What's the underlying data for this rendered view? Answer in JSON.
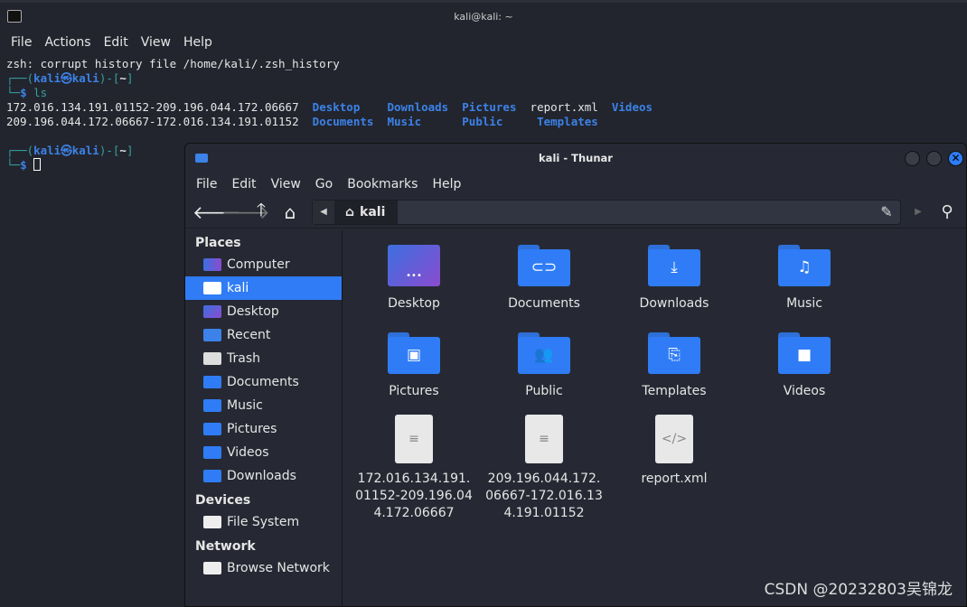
{
  "terminal": {
    "title": "kali@kali: ~",
    "menu": [
      "File",
      "Actions",
      "Edit",
      "View",
      "Help"
    ],
    "warning": "zsh: corrupt history file /home/kali/.zsh_history",
    "prompt_user": "kali",
    "prompt_host": "kali",
    "prompt_dir": "~",
    "command": "ls",
    "ls_files": [
      "172.016.134.191.01152-209.196.044.172.06667",
      "209.196.044.172.06667-172.016.134.191.01152",
      "report.xml"
    ],
    "ls_dirs": [
      "Desktop",
      "Downloads",
      "Pictures",
      "Videos",
      "Documents",
      "Music",
      "Public",
      "Templates"
    ]
  },
  "thunar": {
    "title": "kali - Thunar",
    "menu": [
      "File",
      "Edit",
      "View",
      "Go",
      "Bookmarks",
      "Help"
    ],
    "path": "kali",
    "sidebar": {
      "places_label": "Places",
      "places": [
        "Computer",
        "kali",
        "Desktop",
        "Recent",
        "Trash",
        "Documents",
        "Music",
        "Pictures",
        "Videos",
        "Downloads"
      ],
      "selected": "kali",
      "devices_label": "Devices",
      "devices": [
        "File System"
      ],
      "network_label": "Network",
      "network": [
        "Browse Network"
      ]
    },
    "items": [
      {
        "name": "Desktop",
        "icon": "desktop"
      },
      {
        "name": "Documents",
        "icon": "paperclip"
      },
      {
        "name": "Downloads",
        "icon": "download"
      },
      {
        "name": "Music",
        "icon": "music"
      },
      {
        "name": "Pictures",
        "icon": "image"
      },
      {
        "name": "Public",
        "icon": "people"
      },
      {
        "name": "Templates",
        "icon": "template"
      },
      {
        "name": "Videos",
        "icon": "video"
      },
      {
        "name": "172.016.134.191.01152-209.196.044.172.06667",
        "icon": "text"
      },
      {
        "name": "209.196.044.172.06667-172.016.134.191.01152",
        "icon": "text"
      },
      {
        "name": "report.xml",
        "icon": "xml"
      }
    ]
  },
  "watermark": "CSDN @20232803吴锦龙",
  "colors": {
    "accent": "#2f7cf6",
    "dir": "#3c82e8",
    "prompt": "#35a0a0"
  }
}
